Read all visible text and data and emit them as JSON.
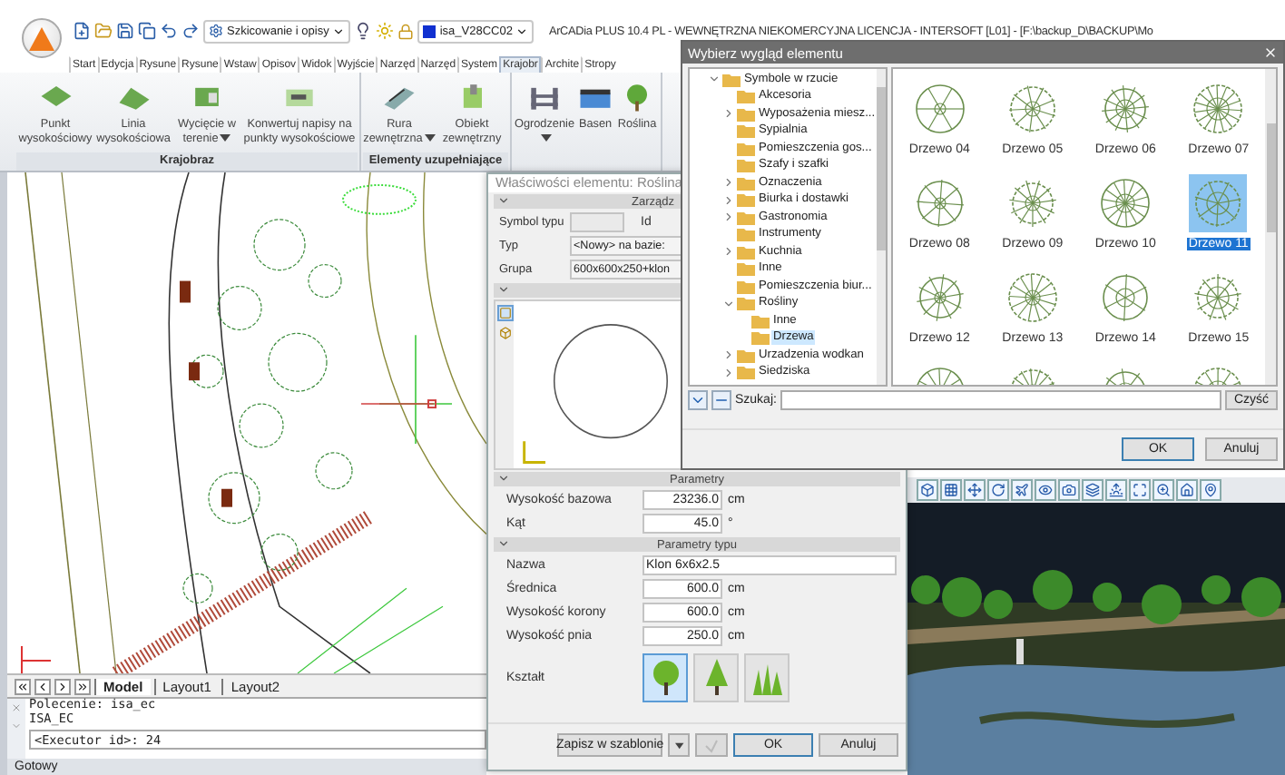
{
  "app": {
    "workspace": "Szkicowanie i opisy",
    "layer": "isa_V28CC02",
    "title": "ArCADia PLUS 10.4 PL - WEWNĘTRZNA NIEKOMERCYJNA LICENCJA - INTERSOFT [L01] - [F:\\backup_D\\BACKUP\\Mo"
  },
  "ribbon_tabs": [
    {
      "label": "Start",
      "selected": false
    },
    {
      "label": "Edycja",
      "selected": false
    },
    {
      "label": "Rysune",
      "selected": false
    },
    {
      "label": "Rysune",
      "selected": false
    },
    {
      "label": "Wstaw",
      "selected": false
    },
    {
      "label": "Opisov",
      "selected": false
    },
    {
      "label": "Widok",
      "selected": false
    },
    {
      "label": "Wyjście",
      "selected": false
    },
    {
      "label": "Narzęd",
      "selected": false
    },
    {
      "label": "Narzęd",
      "selected": false
    },
    {
      "label": "System",
      "selected": false
    },
    {
      "label": "Krajobr",
      "selected": true
    },
    {
      "label": "Archite",
      "selected": false
    },
    {
      "label": "Stropy",
      "selected": false
    }
  ],
  "ribbon_groups": [
    {
      "label": "Krajobraz",
      "tools": [
        {
          "label": "Punkt wysokościowy",
          "kind": "point",
          "dropdown": false
        },
        {
          "label": "Linia wysokościowa",
          "kind": "line",
          "dropdown": false
        },
        {
          "label": "Wycięcie w terenie",
          "kind": "cut",
          "dropdown": true
        },
        {
          "label": "Konwertuj napisy na punkty wysokościowe",
          "kind": "convert",
          "dropdown": false
        }
      ]
    },
    {
      "label": "Elementy uzupełniające",
      "tools": [
        {
          "label": "Rura zewnętrzna",
          "kind": "pipe",
          "dropdown": true
        },
        {
          "label": "Obiekt zewnętrzny",
          "kind": "object",
          "dropdown": false
        }
      ]
    },
    {
      "tools": [
        {
          "label": "Ogrodzenie",
          "kind": "fence",
          "dropdown": true
        },
        {
          "label": "Basen",
          "kind": "pool",
          "dropdown": false
        },
        {
          "label": "Roślina",
          "kind": "plant",
          "dropdown": false
        }
      ]
    }
  ],
  "cad": {
    "layout_tabs": [
      {
        "label": "Model",
        "selected": true
      },
      {
        "label": "Layout1",
        "selected": false
      },
      {
        "label": "Layout2",
        "selected": false
      }
    ],
    "command_history": [
      "Polecenie: isa_ec",
      "ISA_EC"
    ],
    "command_input": "<Executor id>: 24",
    "status": "Gotowy"
  },
  "properties_dialog": {
    "title": "Właściwości elementu: Roślina",
    "management": {
      "header": "Zarządz",
      "id_label": "Id",
      "fields": [
        {
          "label": "Symbol typu"
        },
        {
          "label": "Typ",
          "value": "<Nowy> na bazie:"
        },
        {
          "label": "Grupa",
          "value": "600x600x250+klon"
        }
      ]
    },
    "preview_tools": [
      {
        "kind": "plan",
        "selected": true
      },
      {
        "kind": "view3d",
        "selected": false
      }
    ],
    "parameters": {
      "header": "Parametry",
      "fields": [
        {
          "label": "Wysokość bazowa",
          "value": "23236.0",
          "unit": "cm"
        },
        {
          "label": "Kąt",
          "value": "45.0",
          "unit": "°"
        }
      ]
    },
    "type_parameters": {
      "header": "Parametry typu",
      "name_label": "Nazwa",
      "name_value": "Klon 6x6x2.5",
      "fields": [
        {
          "label": "Średnica",
          "value": "600.0",
          "unit": "cm"
        },
        {
          "label": "Wysokość korony",
          "value": "600.0",
          "unit": "cm"
        },
        {
          "label": "Wysokość pnia",
          "value": "250.0",
          "unit": "cm"
        }
      ],
      "shape_label": "Kształt",
      "shapes": [
        {
          "kind": "deciduous",
          "selected": true
        },
        {
          "kind": "conifer",
          "selected": false
        },
        {
          "kind": "grass",
          "selected": false
        }
      ]
    },
    "buttons": {
      "save": "Zapisz w szablonie",
      "ok": "OK",
      "cancel": "Anuluj"
    }
  },
  "symbol_dialog": {
    "title": "Wybierz wygląd elementu",
    "tree": [
      {
        "label": "Symbole w rzucie",
        "expanded": true,
        "selected": false,
        "children": [
          {
            "label": "Akcesoria",
            "selected": false
          },
          {
            "label": "Wyposażenia miesz...",
            "expanded": false,
            "selected": false
          },
          {
            "label": "Sypialnia",
            "selected": false
          },
          {
            "label": "Pomieszczenia gos...",
            "selected": false
          },
          {
            "label": "Szafy i szafki",
            "selected": false
          },
          {
            "label": "Oznaczenia",
            "expanded": false,
            "selected": false
          },
          {
            "label": "Biurka i dostawki",
            "expanded": false,
            "selected": false
          },
          {
            "label": "Gastronomia",
            "expanded": false,
            "selected": false
          },
          {
            "label": "Instrumenty",
            "selected": false
          },
          {
            "label": "Kuchnia",
            "expanded": false,
            "selected": false
          },
          {
            "label": "Inne",
            "selected": false
          },
          {
            "label": "Pomieszczenia biur...",
            "selected": false
          },
          {
            "label": "Rośliny",
            "expanded": true,
            "selected": false,
            "children": [
              {
                "label": "Inne",
                "selected": false
              },
              {
                "label": "Drzewa",
                "selected": true
              }
            ]
          },
          {
            "label": "Urzadzenia wodkan",
            "expanded": false,
            "selected": false
          },
          {
            "label": "Siedziska",
            "expanded": false,
            "selected": false
          }
        ]
      }
    ],
    "symbols": [
      {
        "label": "Drzewo 04",
        "selected": false
      },
      {
        "label": "Drzewo 05",
        "selected": false
      },
      {
        "label": "Drzewo 06",
        "selected": false
      },
      {
        "label": "Drzewo 07",
        "selected": false
      },
      {
        "label": "Drzewo 08",
        "selected": false
      },
      {
        "label": "Drzewo 09",
        "selected": false
      },
      {
        "label": "Drzewo 10",
        "selected": false
      },
      {
        "label": "Drzewo 11",
        "selected": true
      },
      {
        "label": "Drzewo 12",
        "selected": false
      },
      {
        "label": "Drzewo 13",
        "selected": false
      },
      {
        "label": "Drzewo 14",
        "selected": false
      },
      {
        "label": "Drzewo 15",
        "selected": false
      }
    ],
    "search_label": "Szukaj:",
    "clear": "Czyść",
    "ok": "OK",
    "cancel": "Anuluj"
  }
}
